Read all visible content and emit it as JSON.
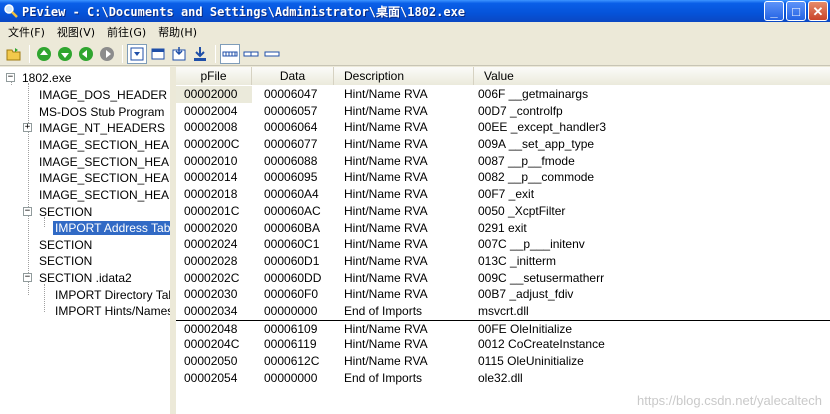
{
  "window": {
    "title": "PEview - C:\\Documents and Settings\\Administrator\\桌面\\1802.exe"
  },
  "menu": [
    {
      "label": "文件(F)"
    },
    {
      "label": "视图(V)"
    },
    {
      "label": "前往(G)"
    },
    {
      "label": "帮助(H)"
    }
  ],
  "toolbar": {
    "icons": [
      "open-file-icon",
      "nav-first-icon",
      "nav-prev-icon",
      "nav-next-icon",
      "nav-last-icon",
      "view-hex-icon",
      "view-raw-icon",
      "view-parsed-icon",
      "view-export-icon",
      "view-byte-icon",
      "view-word-icon",
      "view-dword-icon"
    ]
  },
  "tree": {
    "nodes": [
      {
        "label": "1802.exe",
        "expander": "−"
      },
      {
        "label": "IMAGE_DOS_HEADER"
      },
      {
        "label": "MS-DOS Stub Program"
      },
      {
        "label": "IMAGE_NT_HEADERS",
        "expander": "+"
      },
      {
        "label": "IMAGE_SECTION_HEADER .text"
      },
      {
        "label": "IMAGE_SECTION_HEADER .rdata"
      },
      {
        "label": "IMAGE_SECTION_HEADER .data"
      },
      {
        "label": "IMAGE_SECTION_HEADER .idata"
      },
      {
        "label": "SECTION",
        "expander": "−"
      },
      {
        "label": "IMPORT Address Table"
      },
      {
        "label": "SECTION"
      },
      {
        "label": "SECTION"
      },
      {
        "label": "SECTION .idata2",
        "expander": "−"
      },
      {
        "label": "IMPORT Directory Table"
      },
      {
        "label": "IMPORT Hints/Names & DLL Names"
      }
    ]
  },
  "table": {
    "columns": [
      "pFile",
      "Data",
      "Description",
      "Value"
    ],
    "rows": [
      {
        "pFile": "00002000",
        "data": "00006047",
        "desc": "Hint/Name RVA",
        "value": "006F  __getmainargs"
      },
      {
        "pFile": "00002004",
        "data": "00006057",
        "desc": "Hint/Name RVA",
        "value": "00D7  _controlfp"
      },
      {
        "pFile": "00002008",
        "data": "00006064",
        "desc": "Hint/Name RVA",
        "value": "00EE  _except_handler3"
      },
      {
        "pFile": "0000200C",
        "data": "00006077",
        "desc": "Hint/Name RVA",
        "value": "009A  __set_app_type"
      },
      {
        "pFile": "00002010",
        "data": "00006088",
        "desc": "Hint/Name RVA",
        "value": "0087  __p__fmode"
      },
      {
        "pFile": "00002014",
        "data": "00006095",
        "desc": "Hint/Name RVA",
        "value": "0082  __p__commode"
      },
      {
        "pFile": "00002018",
        "data": "000060A4",
        "desc": "Hint/Name RVA",
        "value": "00F7  _exit"
      },
      {
        "pFile": "0000201C",
        "data": "000060AC",
        "desc": "Hint/Name RVA",
        "value": "0050  _XcptFilter"
      },
      {
        "pFile": "00002020",
        "data": "000060BA",
        "desc": "Hint/Name RVA",
        "value": "0291  exit"
      },
      {
        "pFile": "00002024",
        "data": "000060C1",
        "desc": "Hint/Name RVA",
        "value": "007C  __p___initenv"
      },
      {
        "pFile": "00002028",
        "data": "000060D1",
        "desc": "Hint/Name RVA",
        "value": "013C  _initterm"
      },
      {
        "pFile": "0000202C",
        "data": "000060DD",
        "desc": "Hint/Name RVA",
        "value": "009C  __setusermatherr"
      },
      {
        "pFile": "00002030",
        "data": "000060F0",
        "desc": "Hint/Name RVA",
        "value": "00B7  _adjust_fdiv"
      },
      {
        "pFile": "00002034",
        "data": "00000000",
        "desc": "End of Imports",
        "value": "msvcrt.dll"
      },
      {
        "pFile": "00002048",
        "data": "00006109",
        "desc": "Hint/Name RVA",
        "value": "00FE  OleInitialize"
      },
      {
        "pFile": "0000204C",
        "data": "00006119",
        "desc": "Hint/Name RVA",
        "value": "0012  CoCreateInstance"
      },
      {
        "pFile": "00002050",
        "data": "0000612C",
        "desc": "Hint/Name RVA",
        "value": "0115  OleUninitialize"
      },
      {
        "pFile": "00002054",
        "data": "00000000",
        "desc": "End of Imports",
        "value": "ole32.dll"
      }
    ]
  },
  "watermark": "https://blog.csdn.net/yalecaltech",
  "colors": {
    "titlebar": "#0553d9",
    "selection": "#316ac5",
    "chrome": "#ece9d8",
    "nav_green": "#2fa52f"
  }
}
